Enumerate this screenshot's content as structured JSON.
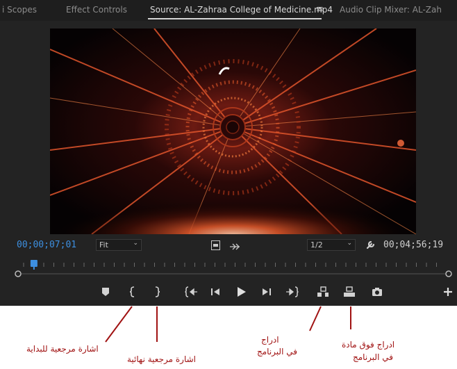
{
  "tabs": [
    {
      "label": "i Scopes"
    },
    {
      "label": "Effect Controls"
    },
    {
      "label": "Source: AL-Zahraa College of Medicine.mp4"
    },
    {
      "label": "Audio Clip Mixer: AL-Zah"
    }
  ],
  "tab_menu_glyph": "≡",
  "timecode": {
    "current": "00;00;07;01",
    "duration": "00;04;56;19"
  },
  "zoom_select": {
    "value": "Fit"
  },
  "resolution_select": {
    "value": "1/2"
  },
  "icons": {
    "settings": "wrench-icon",
    "export_frame": "camera-icon",
    "add": "plus-icon"
  },
  "playhead_position": 0.024,
  "annotations": {
    "mark_in": "اشارة مرجعية للبداية",
    "mark_out": "اشارة مرجعية نهائية",
    "insert_line1": "ادراج",
    "insert_line2": "في البرنامج",
    "overwrite_line1": "ادراج فوق مادة",
    "overwrite_line2": "في البرنامج"
  },
  "colors": {
    "panel_bg": "#232323",
    "timecode_blue": "#3d8fe0",
    "annotation_red": "#a01212"
  }
}
